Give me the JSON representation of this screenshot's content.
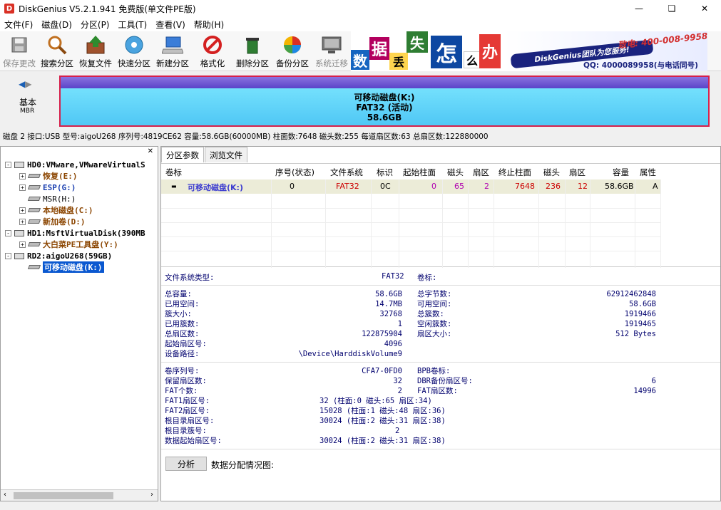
{
  "window": {
    "title": "DiskGenius V5.2.1.941 免费版(单文件PE版)",
    "icon": "D"
  },
  "menu": [
    "文件(F)",
    "磁盘(D)",
    "分区(P)",
    "工具(T)",
    "查看(V)",
    "帮助(H)"
  ],
  "toolbar": {
    "save": "保存更改",
    "search": "搜索分区",
    "recover": "恢复文件",
    "quick": "快速分区",
    "new": "新建分区",
    "format": "格式化",
    "delete": "删除分区",
    "backup": "备份分区",
    "migrate": "系统迁移"
  },
  "banner": {
    "c1": "数",
    "c2": "据",
    "c3": "丢",
    "c4": "失",
    "c5": "怎",
    "c6": "么",
    "c7": "办",
    "team": "DiskGenius团队为您服务!",
    "phone": "致电: 400-008-9958",
    "qq": "QQ: 4000089958(与电话同号)"
  },
  "disk_bar": {
    "basic": "基本",
    "mbr": "MBR",
    "line1": "可移动磁盘(K:)",
    "line2": "FAT32 (活动)",
    "line3": "58.6GB"
  },
  "disk_info": "磁盘 2 接口:USB  型号:aigoU268  序列号:4819CE62  容量:58.6GB(60000MB)  柱面数:7648  磁头数:255  每道扇区数:63  总扇区数:122880000",
  "tree": {
    "hd0": "HD0:VMware,VMwareVirtualS",
    "hd0_p1": "恢复(E:)",
    "hd0_p2": "ESP(G:)",
    "hd0_p3": "MSR(H:)",
    "hd0_p4": "本地磁盘(C:)",
    "hd0_p5": "新加卷(D:)",
    "hd1": "HD1:MsftVirtualDisk(390MB",
    "hd1_p1": "大白菜PE工具盘(Y:)",
    "rd2": "RD2:aigoU268(59GB)",
    "rd2_p1": "可移动磁盘(K:)"
  },
  "tabs": [
    "分区参数",
    "浏览文件"
  ],
  "grid": {
    "headers": [
      "卷标",
      "序号(状态)",
      "文件系统",
      "标识",
      "起始柱面",
      "磁头",
      "扇区",
      "终止柱面",
      "磁头",
      "扇区",
      "容量",
      "属性"
    ],
    "row": [
      "可移动磁盘(K:)",
      "0",
      "FAT32",
      "0C",
      "0",
      "65",
      "2",
      "7648",
      "236",
      "12",
      "58.6GB",
      "A"
    ]
  },
  "details": {
    "fs_type_l": "文件系统类型:",
    "fs_type_v": "FAT32",
    "vol_label_l": "卷标:",
    "total_cap_l": "总容量:",
    "total_cap_v": "58.6GB",
    "total_bytes_l": "总字节数:",
    "total_bytes_v": "62912462848",
    "used_l": "已用空间:",
    "used_v": "14.7MB",
    "free_l": "可用空间:",
    "free_v": "58.6GB",
    "cluster_size_l": "簇大小:",
    "cluster_size_v": "32768",
    "total_clusters_l": "总簇数:",
    "total_clusters_v": "1919466",
    "used_clusters_l": "已用簇数:",
    "used_clusters_v": "1",
    "free_clusters_l": "空闲簇数:",
    "free_clusters_v": "1919465",
    "total_sectors_l": "总扇区数:",
    "total_sectors_v": "122875904",
    "sector_size_l": "扇区大小:",
    "sector_size_v": "512 Bytes",
    "start_sector_l": "起始扇区号:",
    "start_sector_v": "4096",
    "dev_path_l": "设备路径:",
    "dev_path_v": "\\Device\\HarddiskVolume9",
    "serial_l": "卷序列号:",
    "serial_v": "CFA7-0FD0",
    "bpb_l": "BPB卷标:",
    "reserved_l": "保留扇区数:",
    "reserved_v": "32",
    "dbr_l": "DBR备份扇区号:",
    "dbr_v": "6",
    "fat_count_l": "FAT个数:",
    "fat_count_v": "2",
    "fat_sectors_l": "FAT扇区数:",
    "fat_sectors_v": "14996",
    "fat1_l": "FAT1扇区号:",
    "fat1_v": "32 (柱面:0 磁头:65 扇区:34)",
    "fat2_l": "FAT2扇区号:",
    "fat2_v": "15028 (柱面:1 磁头:48 扇区:36)",
    "root_sector_l": "根目录扇区号:",
    "root_sector_v": "30024 (柱面:2 磁头:31 扇区:38)",
    "root_cluster_l": "根目录簇号:",
    "root_cluster_v": "2",
    "data_start_l": "数据起始扇区号:",
    "data_start_v": "30024 (柱面:2 磁头:31 扇区:38)"
  },
  "analyze": {
    "button": "分析",
    "label": "数据分配情况图:"
  }
}
